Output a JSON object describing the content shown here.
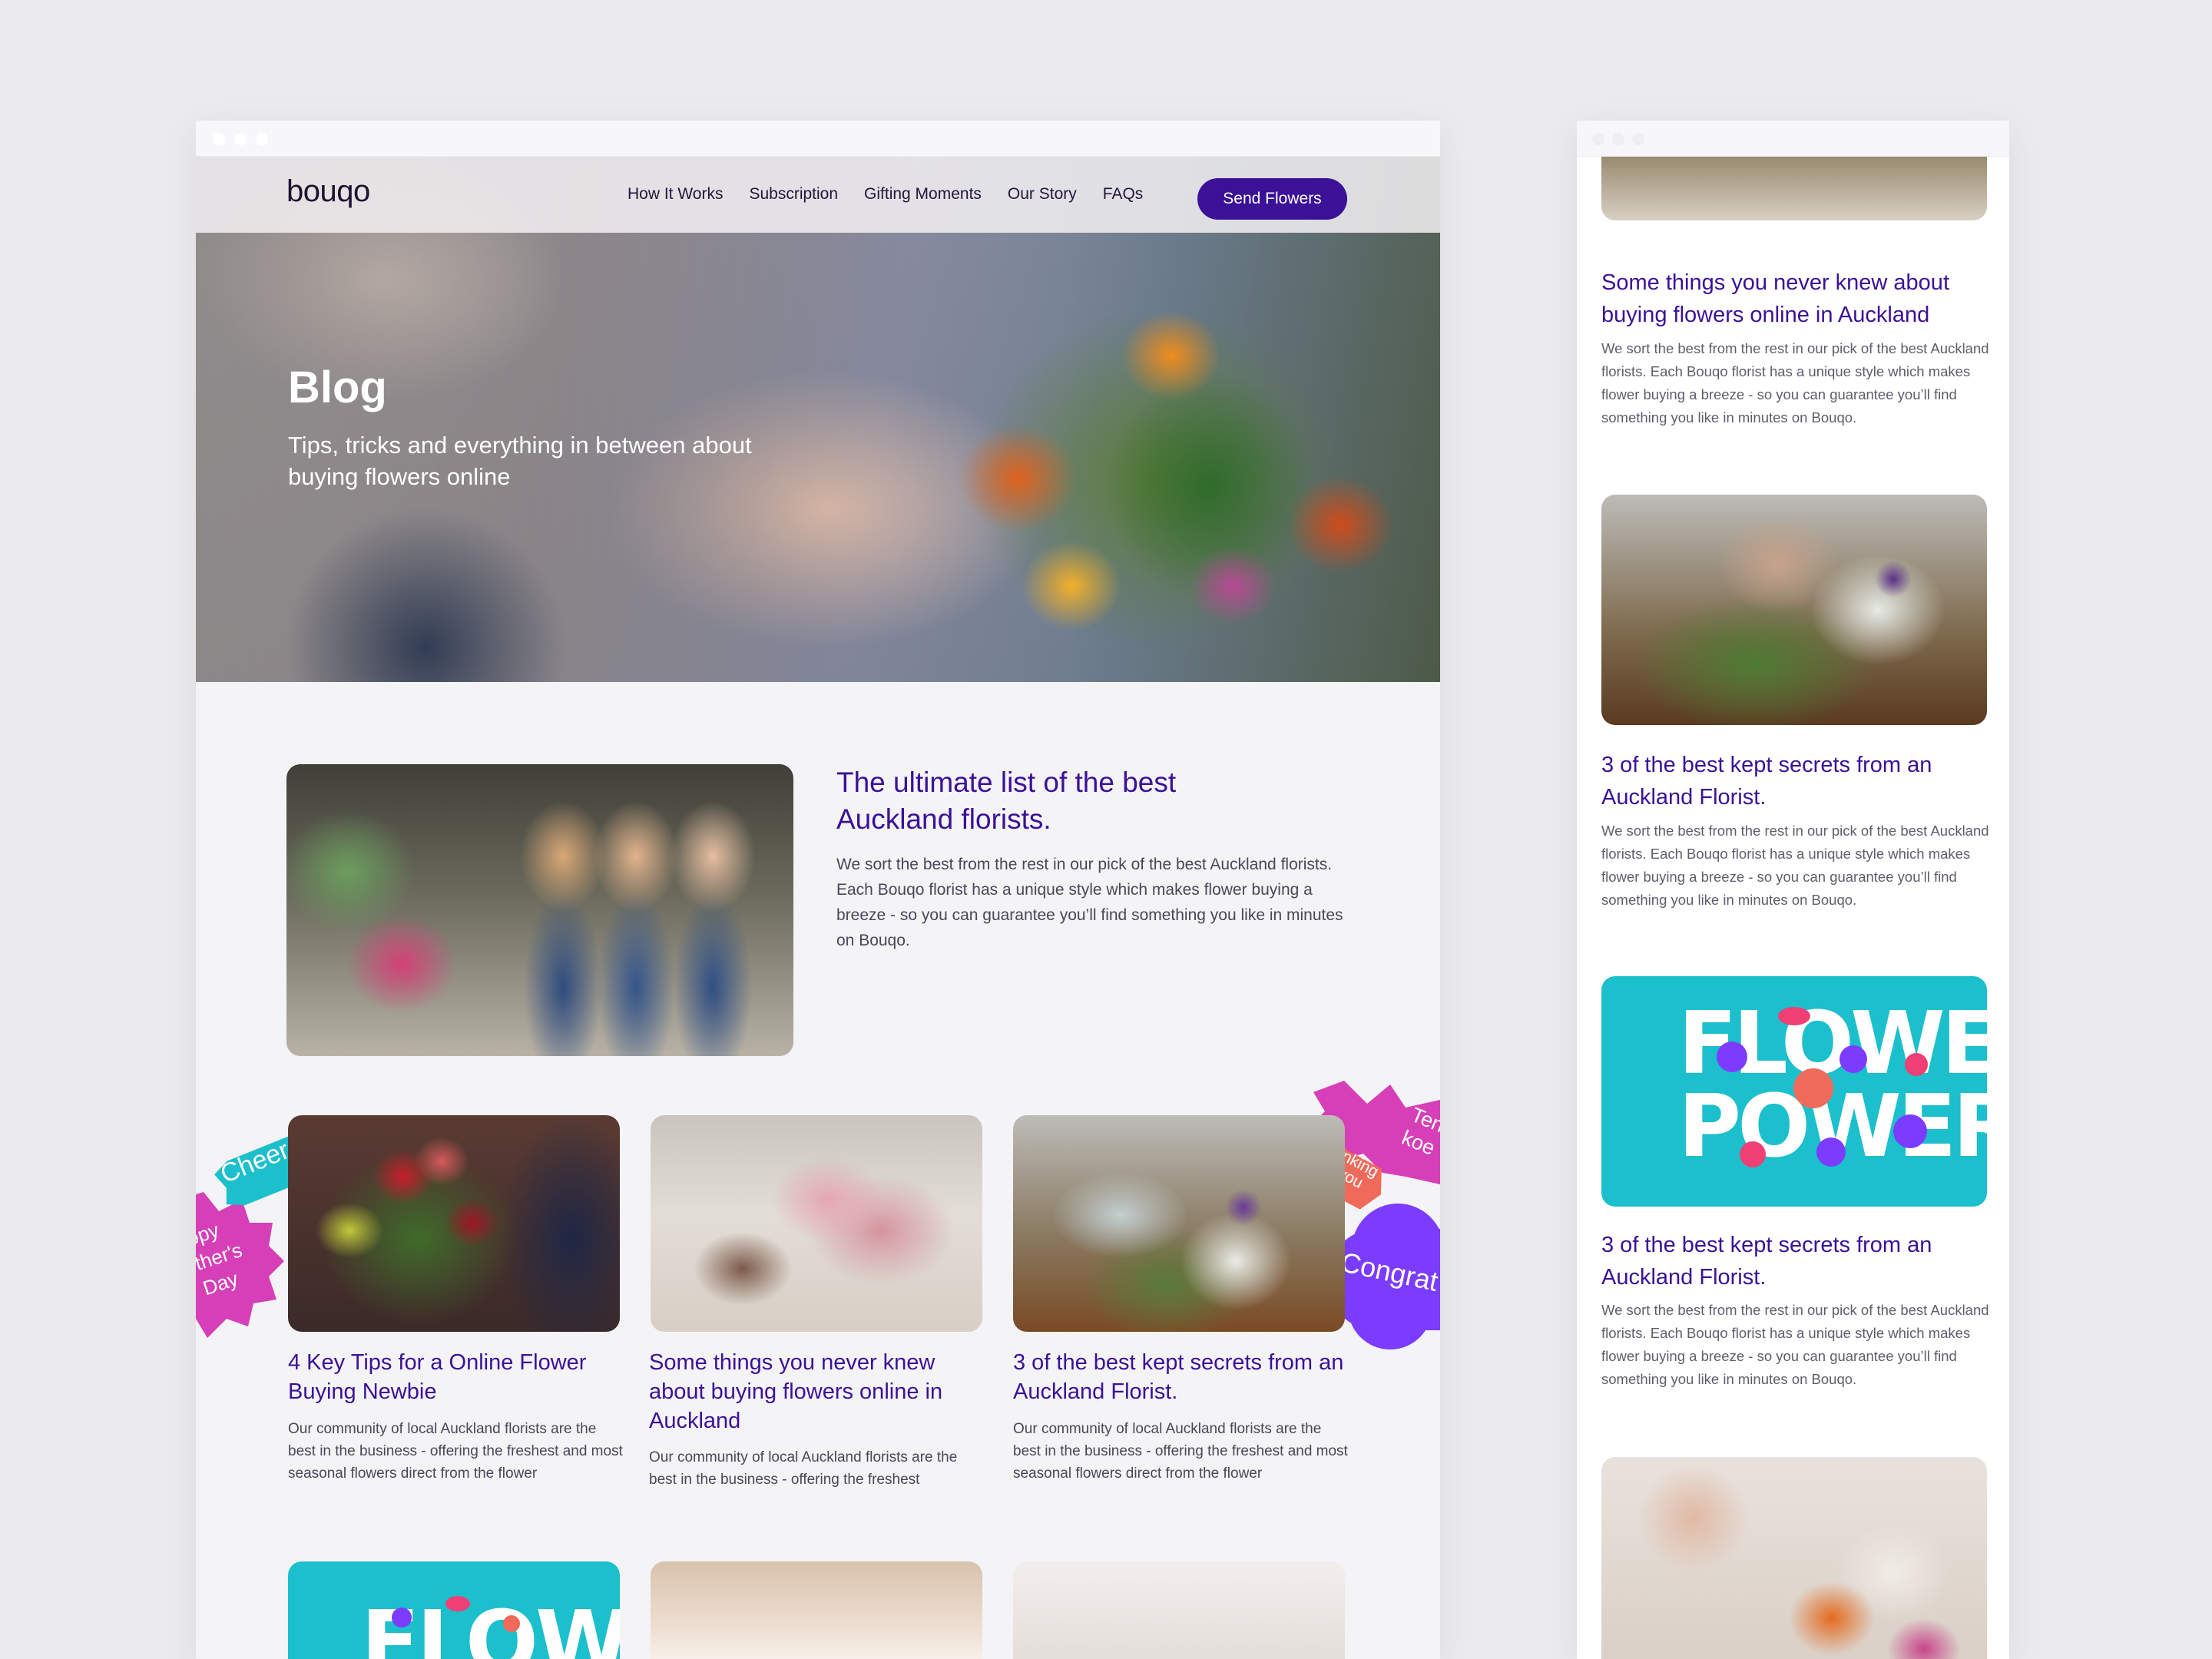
{
  "brand": {
    "logo": "bouqo",
    "accent": "#3b1198",
    "teal": "#1cbfcc",
    "pink": "#d63fb8",
    "coral": "#ef6a5a",
    "violet": "#7b3cff"
  },
  "nav": {
    "links": [
      "How It Works",
      "Subscription",
      "Gifting Moments",
      "Our Story",
      "FAQs"
    ],
    "cta": "Send Flowers"
  },
  "hero": {
    "title": "Blog",
    "subtitle": "Tips, tricks and everything in between about buying flowers online"
  },
  "featured": {
    "title": "The ultimate list of the best Auckland florists.",
    "body": "We sort the best from the rest in our pick of the best Auckland florists. Each Bouqo florist has a unique style which makes flower buying a breeze - so you can guarantee you’ll find something you like in minutes on Bouqo."
  },
  "stickers": {
    "cheers": "Cheers",
    "mothers_day": "ppy\nther's\nDay",
    "thinking": "Thinking\nof you",
    "ten_koe": "Ten\nkoe",
    "congrats": "Congrat"
  },
  "cards": [
    {
      "title": "4 Key Tips for a Online Flower Buying Newbie",
      "body": "Our community of local Auckland florists are the best in the business - offering the freshest and most seasonal flowers direct from the flower"
    },
    {
      "title": "Some things you never knew about buying flowers online in Auckland",
      "body": "Our community of local Auckland florists are the best in the business - offering the freshest"
    },
    {
      "title": "3 of the best kept secrets from an Auckland Florist.",
      "body": "Our community of local Auckland florists are the best in the business - offering the freshest and most seasonal flowers direct from the flower"
    }
  ],
  "flower_power_text": "FLOWER POWER",
  "flower_partial_text": "FLOWER",
  "side_posts": [
    {
      "title": "Some things you never knew about buying flowers online in Auckland",
      "body": "We sort the best from the rest in our pick of the best Auckland florists. Each Bouqo florist has a unique style which makes flower buying a breeze - so you can guarantee you’ll find something you like in minutes on Bouqo."
    },
    {
      "title": "3 of the best kept secrets from an Auckland Florist.",
      "body": "We sort the best from the rest in our pick of the best Auckland florists. Each Bouqo florist has a unique style which makes flower buying a breeze - so you can guarantee you’ll find something you like in minutes on Bouqo."
    },
    {
      "title": "3 of the best kept secrets from an Auckland Florist.",
      "body": "We sort the best from the rest in our pick of the best Auckland florists. Each Bouqo florist has a unique style which makes flower buying a breeze - so you can guarantee you’ll find something you like in minutes on Bouqo."
    }
  ]
}
